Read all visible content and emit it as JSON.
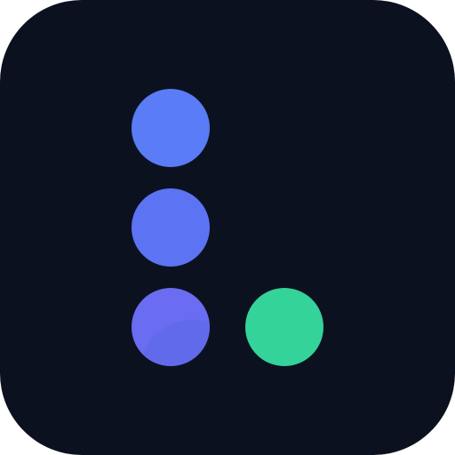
{
  "logo": {
    "icon_name": "dots-l-logo-icon",
    "colors": {
      "background": "#0c1120",
      "dot_top": "#5a7cf6",
      "dot_middle": "#5c73f3",
      "dot_bottom": "#6a6cf1",
      "dot_bottom_sheen": "#5a6ae6",
      "dot_accent": "#34d399"
    }
  }
}
